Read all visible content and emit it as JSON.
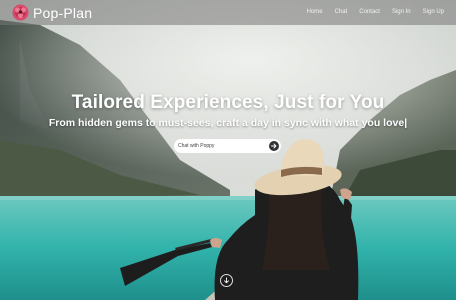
{
  "brand": {
    "name": "Pop-Plan",
    "logo_icon": "flower-logo-icon"
  },
  "nav": {
    "items": [
      {
        "label": "Home"
      },
      {
        "label": "Chat"
      },
      {
        "label": "Contact"
      },
      {
        "label": "Sign In"
      },
      {
        "label": "Sign Up"
      }
    ]
  },
  "hero": {
    "title": "Tailored Experiences, Just for You",
    "subtitle": "From hidden gems to must-sees, craft a day in sync with what you love|"
  },
  "chat": {
    "placeholder": "Chat with Poppy",
    "send_icon": "arrow-right-icon"
  },
  "scroll": {
    "icon": "arrow-down-circle-icon"
  },
  "colors": {
    "header_bg": "#787878",
    "lake": "#2fb7b0",
    "hat": "#e6d3b3",
    "send_button": "#2f3134"
  }
}
